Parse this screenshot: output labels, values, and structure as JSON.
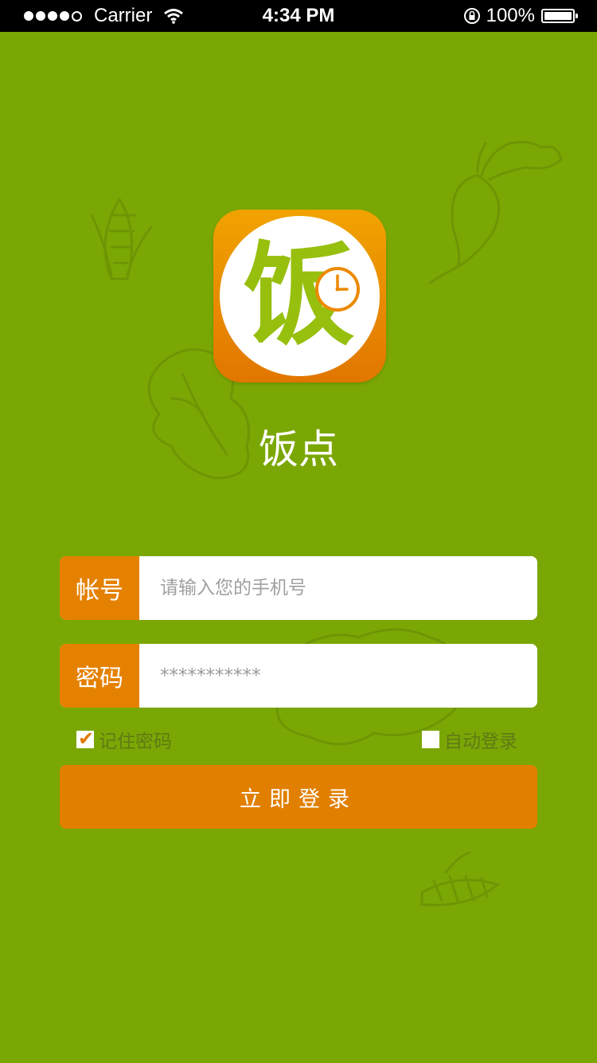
{
  "status_bar": {
    "carrier": "Carrier",
    "time": "4:34 PM",
    "battery": "100%"
  },
  "app": {
    "logo_glyph": "饭",
    "name": "饭点"
  },
  "form": {
    "account": {
      "label": "帐号",
      "placeholder": "请输入您的手机号"
    },
    "password": {
      "label": "密码",
      "value": "***********"
    },
    "remember_password": {
      "label": "记住密码",
      "checked": true
    },
    "auto_login": {
      "label": "自动登录",
      "checked": false
    },
    "submit_label": "立即登录"
  },
  "colors": {
    "background": "#7ba705",
    "accent": "#e17f00",
    "logo_green": "#97bf0d"
  }
}
